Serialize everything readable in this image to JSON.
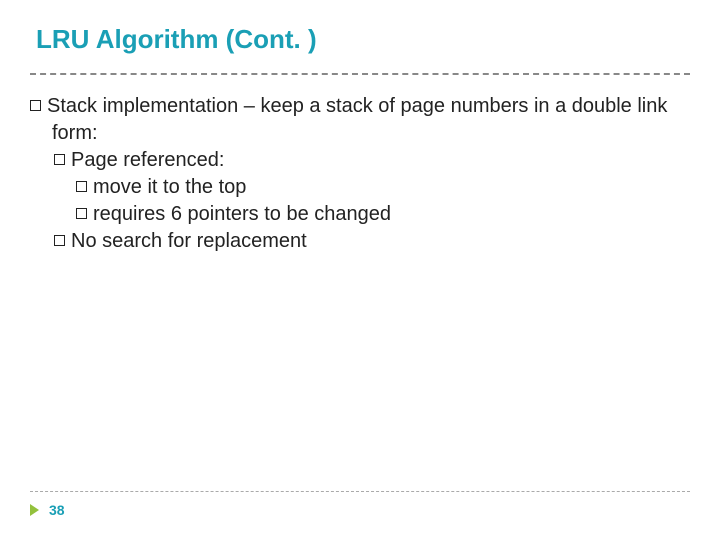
{
  "title": "LRU Algorithm (Cont. )",
  "bullets": {
    "l1": {
      "stack_pre": "Stack",
      "stack_post": " implementation – keep a stack of page numbers in a double link form:",
      "l2a_pre": "Page",
      "l2a_post": " referenced:",
      "l3a_pre": "move",
      "l3a_post": " it to the top",
      "l3b_pre": "requires",
      "l3b_post": " 6 pointers to be changed",
      "l2b_pre": "No",
      "l2b_post": " search for replacement"
    }
  },
  "page_number": "38"
}
